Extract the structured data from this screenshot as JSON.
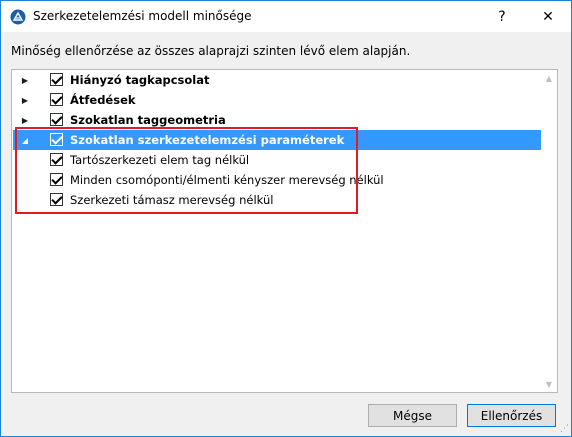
{
  "window": {
    "title": "Szerkezetelemzési modell minősége",
    "help_glyph": "?",
    "close_glyph": "✕"
  },
  "description": "Minőség ellenőrzése az összes alaprajzi szinten lévő elem alapján.",
  "tree": {
    "items": [
      {
        "label": "Hiányzó tagkapcsolat",
        "checked": true,
        "expander": "▶",
        "bold": true,
        "level": 0
      },
      {
        "label": "Átfedések",
        "checked": true,
        "expander": "▶",
        "bold": true,
        "level": 0
      },
      {
        "label": "Szokatlan taggeometria",
        "checked": true,
        "expander": "▶",
        "bold": true,
        "level": 0
      },
      {
        "label": "Szokatlan szerkezetelemzési paraméterek",
        "checked": true,
        "expander": "◢",
        "bold": true,
        "level": 0,
        "selected": true
      },
      {
        "label": "Tartószerkezeti elem tag nélkül",
        "checked": true,
        "level": 1
      },
      {
        "label": "Minden csomóponti/élmenti kényszer merevség nélkül",
        "checked": true,
        "level": 1
      },
      {
        "label": "Szerkezeti támasz merevség nélkül",
        "checked": true,
        "level": 1
      }
    ]
  },
  "buttons": {
    "cancel": "Mégse",
    "ok": "Ellenőrzés"
  },
  "colors": {
    "selection": "#3399ff",
    "highlight_box": "#e11b22",
    "window_border": "#1883d7"
  }
}
